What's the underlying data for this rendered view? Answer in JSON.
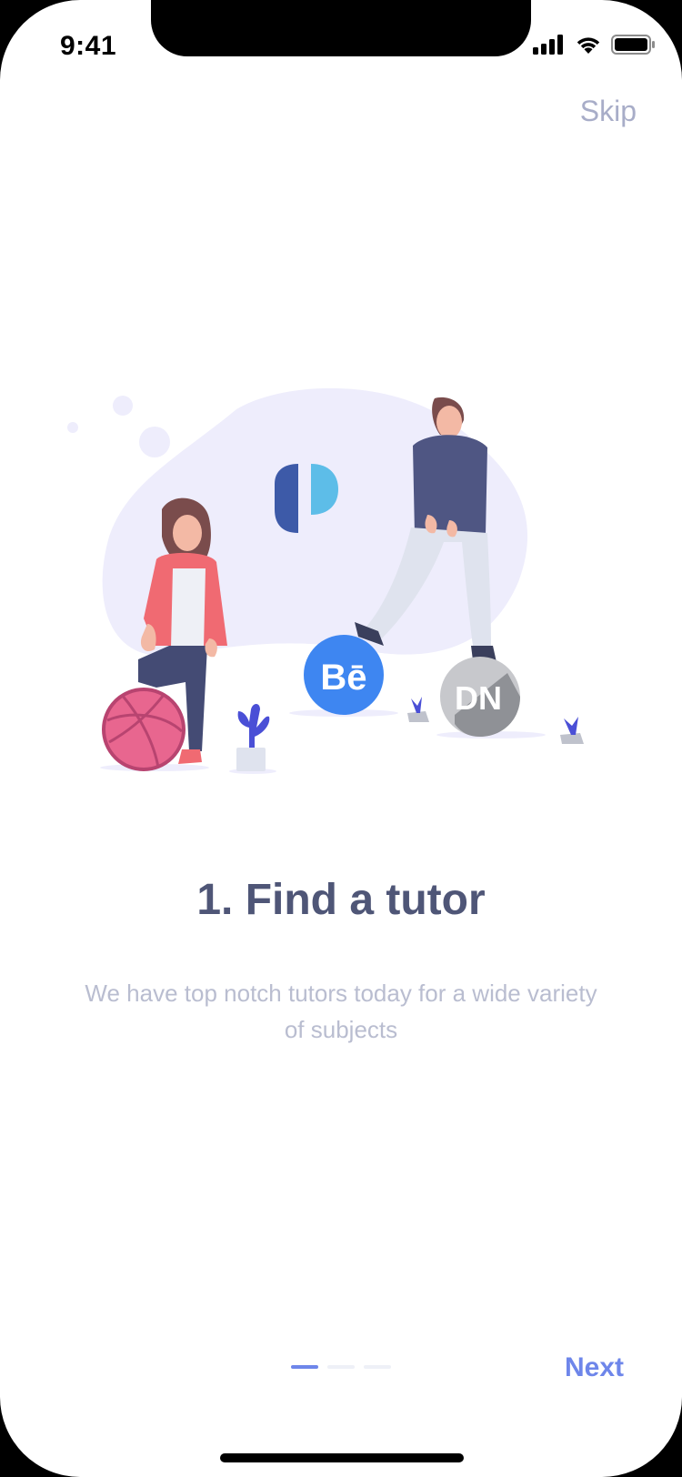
{
  "status_bar": {
    "time": "9:41",
    "icons": [
      "signal-icon",
      "wifi-icon",
      "battery-icon"
    ]
  },
  "header": {
    "skip_label": "Skip"
  },
  "illustration": {
    "behance_label": "Bē",
    "designer_news_label": "DN"
  },
  "onboarding": {
    "title": "1. Find a tutor",
    "subtitle": "We have top notch tutors today for a wide variety of subjects"
  },
  "footer": {
    "next_label": "Next",
    "pager": {
      "total": 3,
      "active_index": 0
    }
  },
  "colors": {
    "accent": "#6e86ea",
    "title": "#4f5677",
    "muted": "#b9bdd0",
    "skip": "#a8adc8",
    "blob": "#eeedfc"
  }
}
